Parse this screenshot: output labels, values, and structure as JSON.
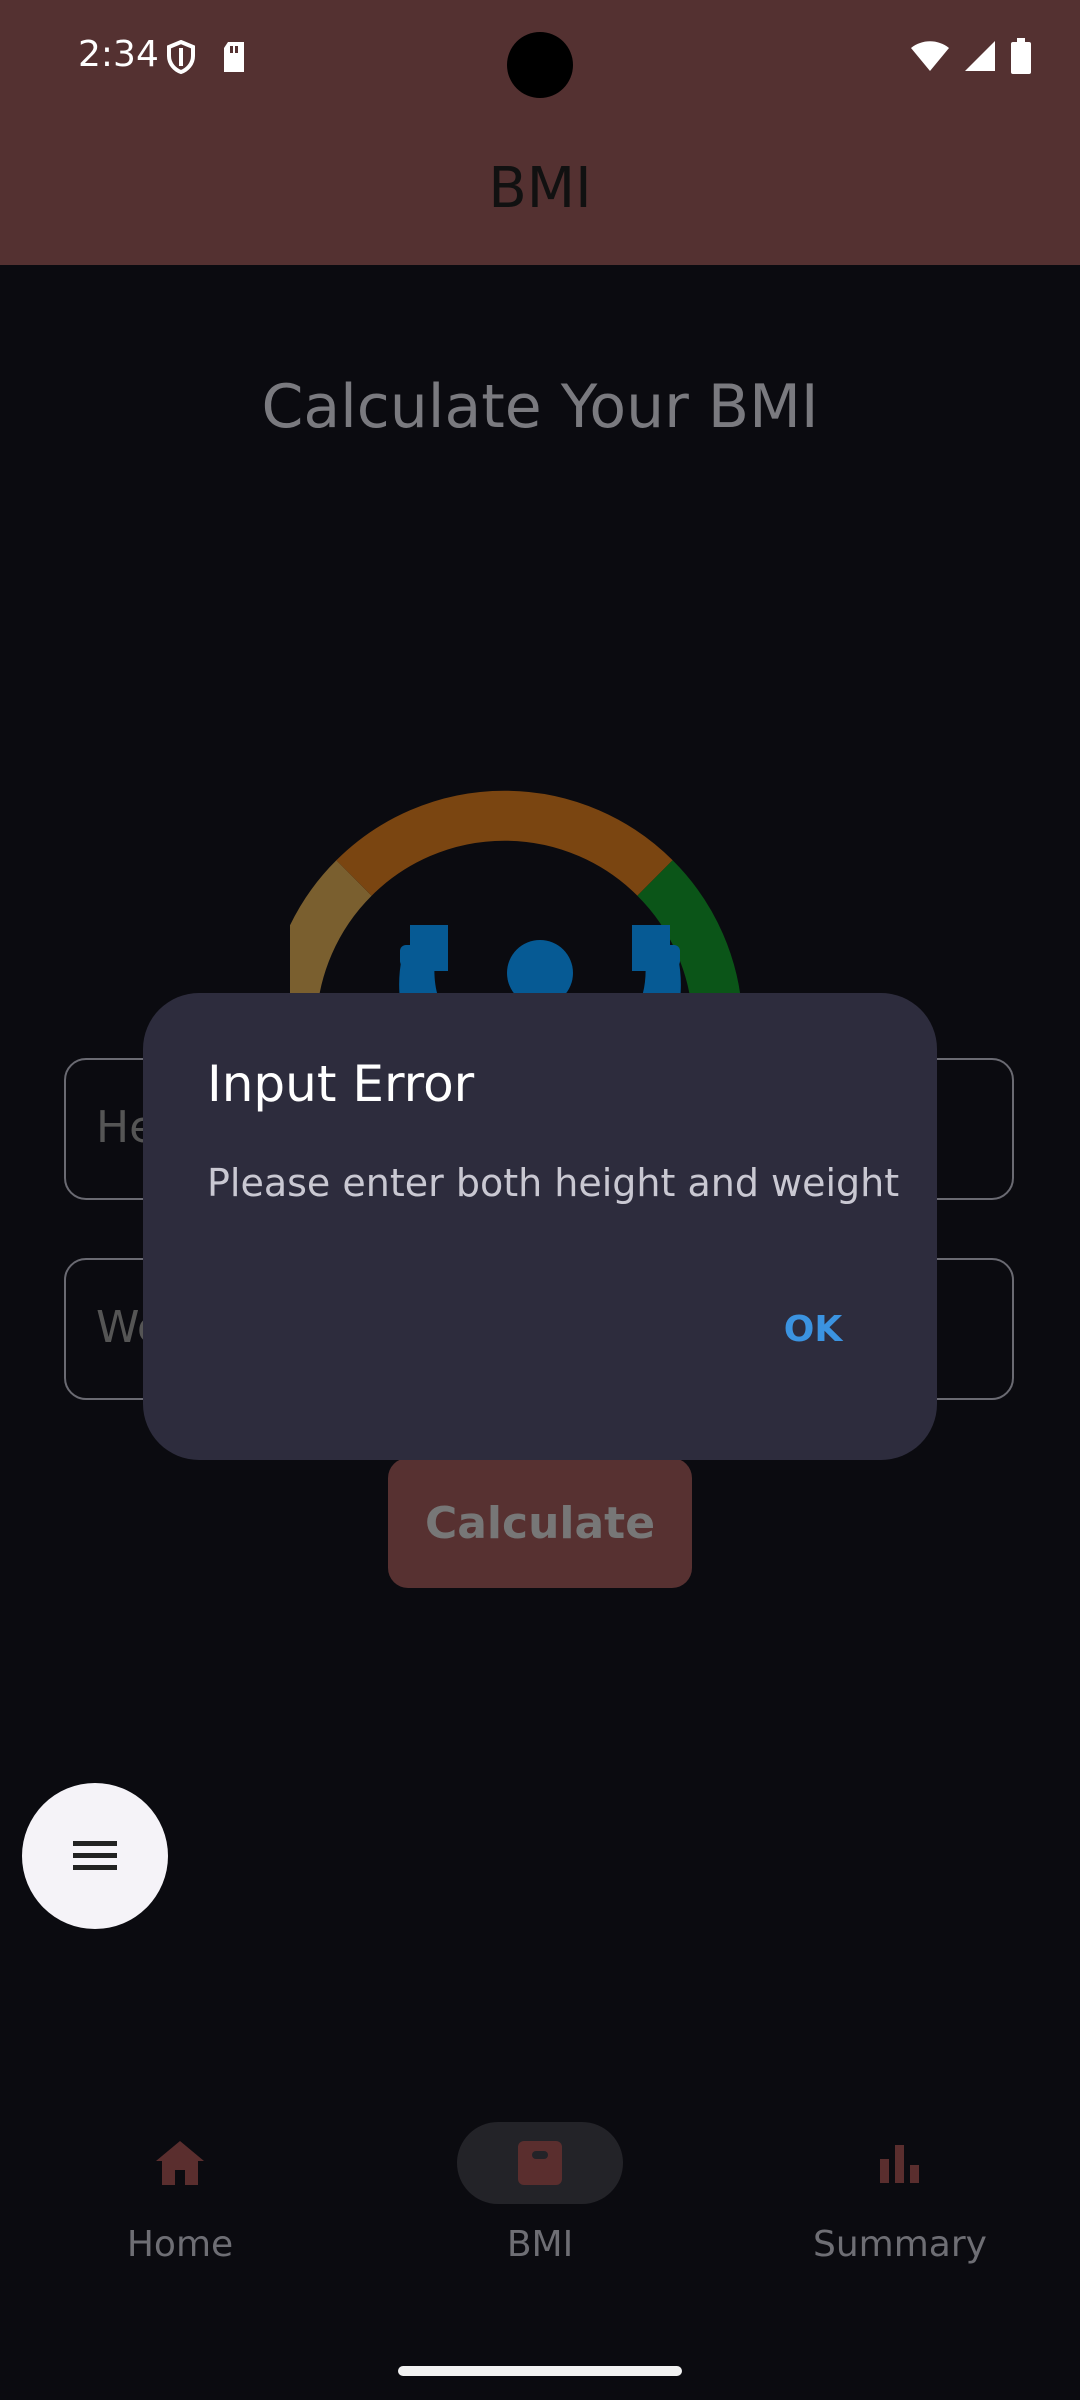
{
  "status_bar": {
    "time": "2:34",
    "icons_left": [
      "shield-icon",
      "sd-card-icon"
    ],
    "icons_right": [
      "wifi-icon",
      "cellular-icon",
      "battery-icon"
    ]
  },
  "app_bar": {
    "title": "BMI"
  },
  "main": {
    "heading": "Calculate Your BMI",
    "height_field": {
      "placeholder": "He"
    },
    "weight_field": {
      "placeholder": "We"
    },
    "calculate_label": "Calculate",
    "gauge_colors": {
      "left": "#7a5f2f",
      "top": "#7a4511",
      "right": "#0b5518",
      "figure": "#065a94",
      "base": "#6f6f6f"
    }
  },
  "dialog": {
    "title": "Input Error",
    "message": "Please enter both height and weight",
    "ok_label": "OK"
  },
  "fab": {
    "icon": "menu-icon"
  },
  "bottom_nav": {
    "items": [
      {
        "label": "Home",
        "icon": "home-icon",
        "active": false
      },
      {
        "label": "BMI",
        "icon": "scale-icon",
        "active": true
      },
      {
        "label": "Summary",
        "icon": "bar-chart-icon",
        "active": false
      }
    ]
  },
  "colors": {
    "accent": "#543131",
    "background": "#0b0b10",
    "dialog_bg": "#2d2c3d",
    "ok_button": "#3b93e0"
  }
}
